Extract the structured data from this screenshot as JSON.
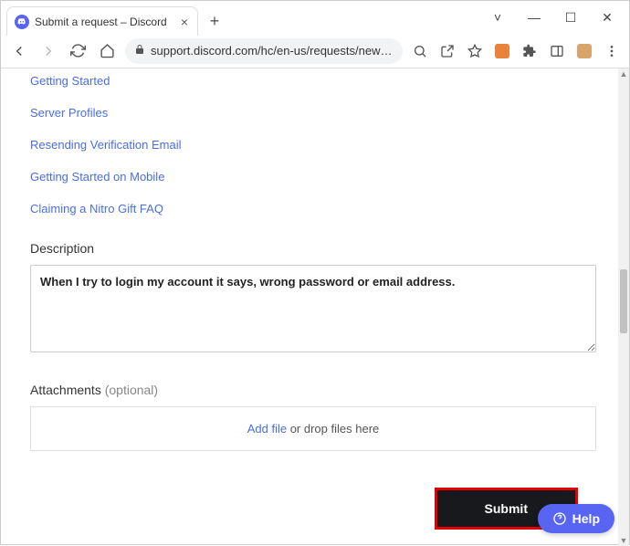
{
  "browser": {
    "tab_title": "Submit a request – Discord",
    "url_display": "support.discord.com/hc/en-us/requests/new?tic..."
  },
  "links": [
    "Getting Started",
    "Server Profiles",
    "Resending Verification Email",
    "Getting Started on Mobile",
    "Claiming a Nitro Gift FAQ"
  ],
  "form": {
    "description_label": "Description",
    "description_value": "When I try to login my account it says, wrong password or email address.",
    "attachments_label": "Attachments",
    "attachments_optional": "(optional)",
    "addfile_text": "Add file",
    "dropfiles_text": " or drop files here",
    "submit_label": "Submit"
  },
  "help_label": "Help"
}
